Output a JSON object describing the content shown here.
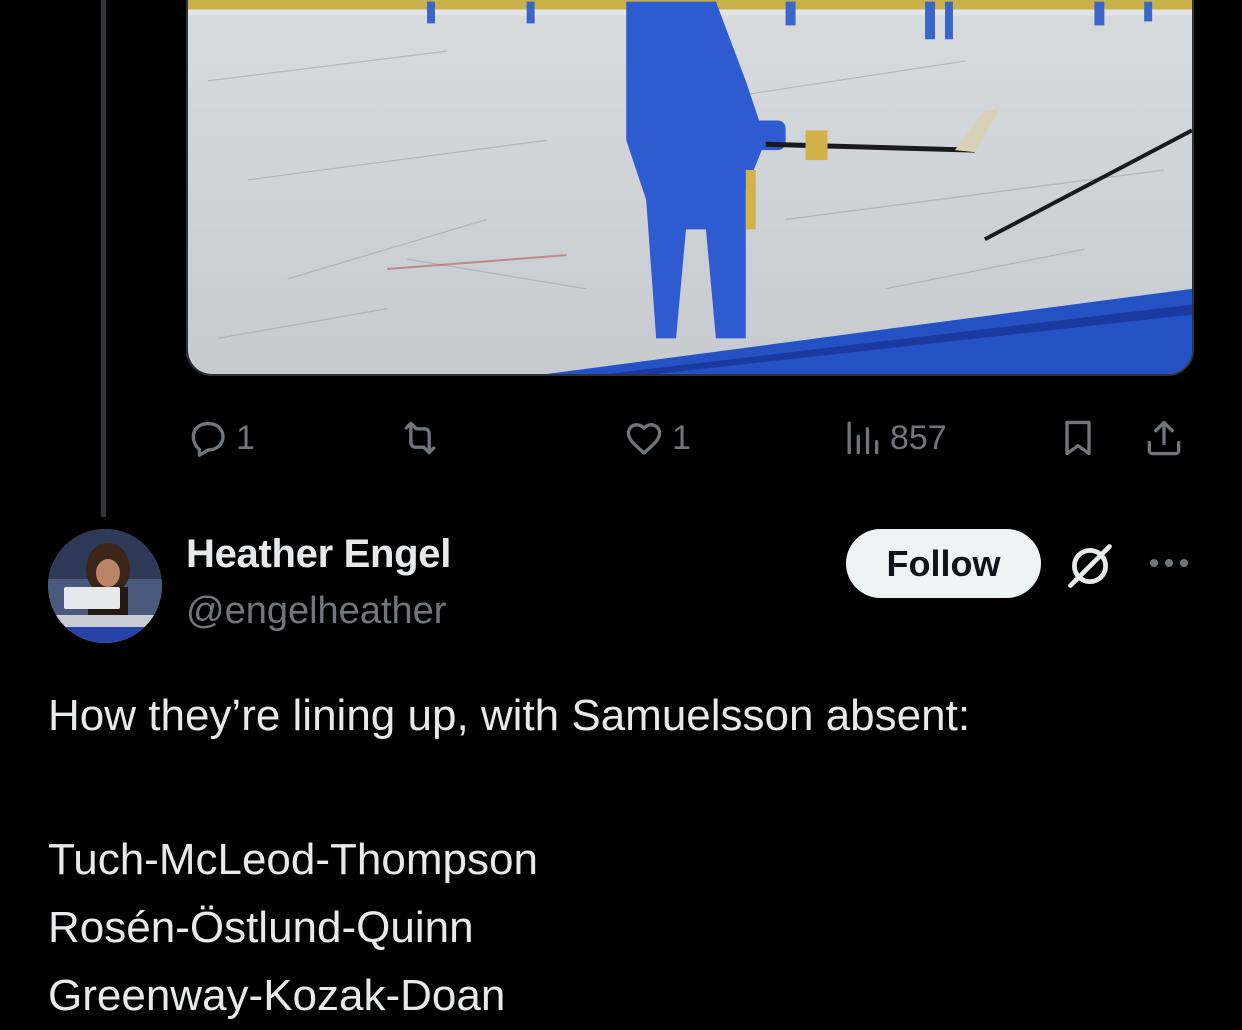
{
  "previous_tweet": {
    "media_alt_icon": "hockey-practice-photo",
    "actions": {
      "reply_count": "1",
      "retweet_count": "",
      "like_count": "1",
      "views_count": "857"
    }
  },
  "tweet": {
    "author": {
      "display_name": "Heather Engel",
      "handle": "@engelheather"
    },
    "follow_label": "Follow",
    "text_intro": "How they’re lining up, with Samuelsson absent:",
    "lines": [
      "Tuch-McLeod-Thompson",
      "Rosén-Östlund-Quinn",
      "Greenway-Kozak-Doan"
    ]
  },
  "colors": {
    "background": "#000000",
    "text_primary": "#e7e9ea",
    "text_secondary": "#71767b",
    "follow_bg": "#eff3f4",
    "thread_line": "#333639"
  },
  "icons": {
    "reply": "reply-bubble-icon",
    "retweet": "retweet-icon",
    "like": "heart-icon",
    "views": "views-bar-chart-icon",
    "bookmark": "bookmark-icon",
    "share": "share-upload-icon",
    "grok": "grok-slash-icon",
    "more": "more-dots-icon"
  }
}
